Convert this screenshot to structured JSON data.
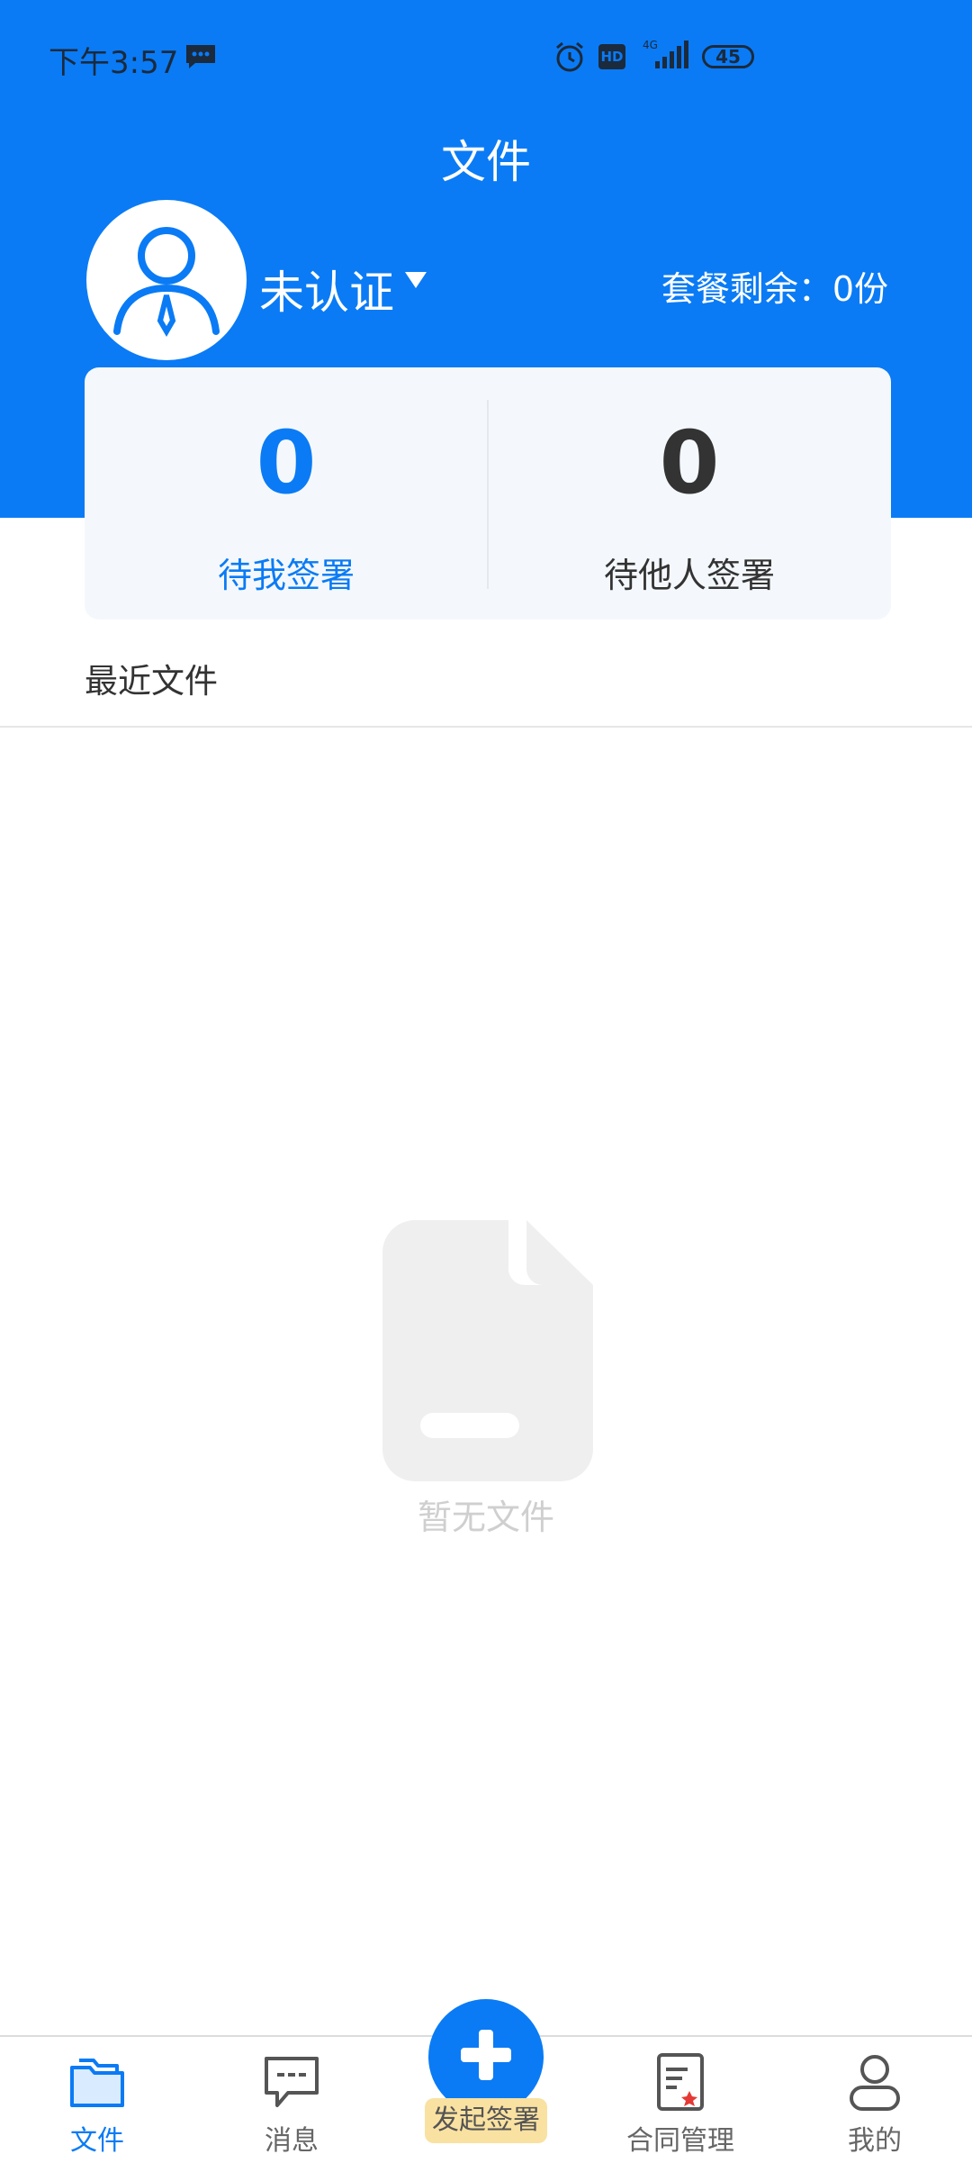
{
  "status_bar": {
    "time": "下午3:57",
    "network": "4G",
    "hd_label": "HD",
    "battery": "45",
    "icons": [
      "message-icon",
      "alarm-icon",
      "hd-icon",
      "signal-icon",
      "battery-icon"
    ]
  },
  "header": {
    "title": "文件",
    "cert_status": "未认证",
    "plan_remaining": "套餐剩余：0份"
  },
  "stats": {
    "pending_me": {
      "value": "0",
      "label": "待我签署"
    },
    "pending_others": {
      "value": "0",
      "label": "待他人签署"
    }
  },
  "recent": {
    "title": "最近文件",
    "empty_text": "暂无文件"
  },
  "tabs": [
    {
      "label": "文件",
      "icon": "folder-icon",
      "active": true
    },
    {
      "label": "消息",
      "icon": "chat-icon",
      "active": false
    },
    {
      "label": "发起签署",
      "icon": "plus-icon",
      "active": false
    },
    {
      "label": "合同管理",
      "icon": "contract-icon",
      "active": false
    },
    {
      "label": "我的",
      "icon": "user-icon",
      "active": false
    }
  ],
  "colors": {
    "primary": "#0A7BF5",
    "card_bg": "#F4F8FC",
    "highlight_label_bg": "#F9E1A1"
  }
}
